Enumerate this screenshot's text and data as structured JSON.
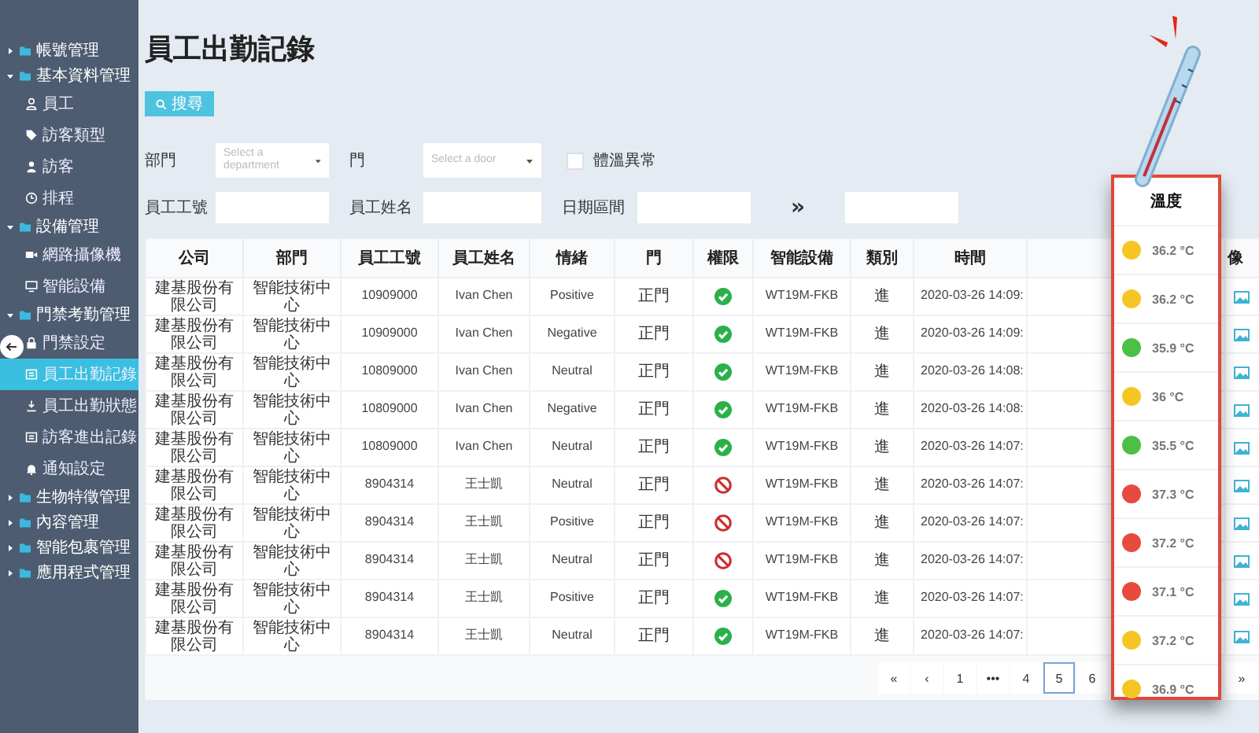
{
  "sidebar": {
    "items": [
      {
        "label": "帳號管理",
        "expanded": false
      },
      {
        "label": "基本資料管理",
        "expanded": true,
        "children": [
          {
            "label": "員工",
            "kind": "person-outline",
            "selected": false
          },
          {
            "label": "訪客類型",
            "kind": "tag",
            "selected": false
          },
          {
            "label": "訪客",
            "kind": "person",
            "selected": false
          },
          {
            "label": "排程",
            "kind": "clock",
            "selected": false
          }
        ]
      },
      {
        "label": "設備管理",
        "expanded": true,
        "children": [
          {
            "label": "網路攝像機",
            "kind": "camera",
            "selected": false
          },
          {
            "label": "智能設備",
            "kind": "monitor",
            "selected": false
          }
        ]
      },
      {
        "label": "門禁考勤管理",
        "expanded": true,
        "children": [
          {
            "label": "門禁設定",
            "kind": "lock",
            "selected": false
          },
          {
            "label": "員工出勤記錄",
            "kind": "list",
            "selected": true
          },
          {
            "label": "員工出勤狀態",
            "kind": "download",
            "selected": false
          },
          {
            "label": "訪客進出記錄",
            "kind": "list",
            "selected": false
          },
          {
            "label": "通知設定",
            "kind": "bell",
            "selected": false
          }
        ]
      },
      {
        "label": "生物特徵管理",
        "expanded": false
      },
      {
        "label": "內容管理",
        "expanded": false
      },
      {
        "label": "智能包裹管理",
        "expanded": false
      },
      {
        "label": "應用程式管理",
        "expanded": false
      }
    ]
  },
  "page": {
    "title": "員工出勤記錄",
    "search_button": "搜尋"
  },
  "filters": {
    "department": {
      "label": "部門",
      "placeholder": "Select a department"
    },
    "door": {
      "label": "門",
      "placeholder": "Select a door"
    },
    "abnormal_temperature": {
      "label": "體溫異常",
      "checked": false
    },
    "employee_id": {
      "label": "員工工號"
    },
    "employee_name": {
      "label": "員工姓名"
    },
    "date_range": {
      "label": "日期區間",
      "separator": "»"
    }
  },
  "table": {
    "columns": [
      "公司",
      "部門",
      "員工工號",
      "員工姓名",
      "情緒",
      "門",
      "權限",
      "智能設備",
      "類別",
      "時間",
      "像"
    ],
    "rows": [
      {
        "company": "建基股份有限公司",
        "department": "智能技術中心",
        "employee_id": "10909000",
        "employee_name": "Ivan Chen",
        "emotion": "Positive",
        "door": "正門",
        "permission_granted": true,
        "device": "WT19M-FKB",
        "category": "進",
        "time": "2020-03-26 14:09:",
        "temperature": {
          "value": "36.2 °C",
          "color": "#f5c623"
        }
      },
      {
        "company": "建基股份有限公司",
        "department": "智能技術中心",
        "employee_id": "10909000",
        "employee_name": "Ivan Chen",
        "emotion": "Negative",
        "door": "正門",
        "permission_granted": true,
        "device": "WT19M-FKB",
        "category": "進",
        "time": "2020-03-26 14:09:",
        "temperature": {
          "value": "36.2 °C",
          "color": "#f5c623"
        }
      },
      {
        "company": "建基股份有限公司",
        "department": "智能技術中心",
        "employee_id": "10809000",
        "employee_name": "Ivan Chen",
        "emotion": "Neutral",
        "door": "正門",
        "permission_granted": true,
        "device": "WT19M-FKB",
        "category": "進",
        "time": "2020-03-26 14:08:",
        "temperature": {
          "value": "35.9 °C",
          "color": "#4cbf45"
        }
      },
      {
        "company": "建基股份有限公司",
        "department": "智能技術中心",
        "employee_id": "10809000",
        "employee_name": "Ivan Chen",
        "emotion": "Negative",
        "door": "正門",
        "permission_granted": true,
        "device": "WT19M-FKB",
        "category": "進",
        "time": "2020-03-26 14:08:",
        "temperature": {
          "value": "36 °C",
          "color": "#f5c623"
        }
      },
      {
        "company": "建基股份有限公司",
        "department": "智能技術中心",
        "employee_id": "10809000",
        "employee_name": "Ivan Chen",
        "emotion": "Neutral",
        "door": "正門",
        "permission_granted": true,
        "device": "WT19M-FKB",
        "category": "進",
        "time": "2020-03-26 14:07:",
        "temperature": {
          "value": "35.5 °C",
          "color": "#4cbf45"
        }
      },
      {
        "company": "建基股份有限公司",
        "department": "智能技術中心",
        "employee_id": "8904314",
        "employee_name": "王士凱",
        "emotion": "Neutral",
        "door": "正門",
        "permission_granted": false,
        "device": "WT19M-FKB",
        "category": "進",
        "time": "2020-03-26 14:07:",
        "temperature": {
          "value": "37.3 °C",
          "color": "#e84a3f"
        }
      },
      {
        "company": "建基股份有限公司",
        "department": "智能技術中心",
        "employee_id": "8904314",
        "employee_name": "王士凱",
        "emotion": "Positive",
        "door": "正門",
        "permission_granted": false,
        "device": "WT19M-FKB",
        "category": "進",
        "time": "2020-03-26 14:07:",
        "temperature": {
          "value": "37.2 °C",
          "color": "#e84a3f"
        }
      },
      {
        "company": "建基股份有限公司",
        "department": "智能技術中心",
        "employee_id": "8904314",
        "employee_name": "王士凱",
        "emotion": "Neutral",
        "door": "正門",
        "permission_granted": false,
        "device": "WT19M-FKB",
        "category": "進",
        "time": "2020-03-26 14:07:",
        "temperature": {
          "value": "37.1 °C",
          "color": "#e84a3f"
        }
      },
      {
        "company": "建基股份有限公司",
        "department": "智能技術中心",
        "employee_id": "8904314",
        "employee_name": "王士凱",
        "emotion": "Positive",
        "door": "正門",
        "permission_granted": true,
        "device": "WT19M-FKB",
        "category": "進",
        "time": "2020-03-26 14:07:",
        "temperature": {
          "value": "37.2 °C",
          "color": "#f5c623"
        }
      },
      {
        "company": "建基股份有限公司",
        "department": "智能技術中心",
        "employee_id": "8904314",
        "employee_name": "王士凱",
        "emotion": "Neutral",
        "door": "正門",
        "permission_granted": true,
        "device": "WT19M-FKB",
        "category": "進",
        "time": "2020-03-26 14:07:",
        "temperature": {
          "value": "36.9 °C",
          "color": "#f5c623"
        }
      }
    ]
  },
  "pagination": {
    "pages": [
      {
        "label": "«",
        "selected": false
      },
      {
        "label": "‹",
        "selected": false
      },
      {
        "label": "1",
        "selected": false
      },
      {
        "label": "•••",
        "selected": false
      },
      {
        "label": "4",
        "selected": false
      },
      {
        "label": "5",
        "selected": true
      },
      {
        "label": "6",
        "selected": false
      }
    ],
    "last": "»"
  },
  "temperature_popup": {
    "title": "溫度"
  }
}
